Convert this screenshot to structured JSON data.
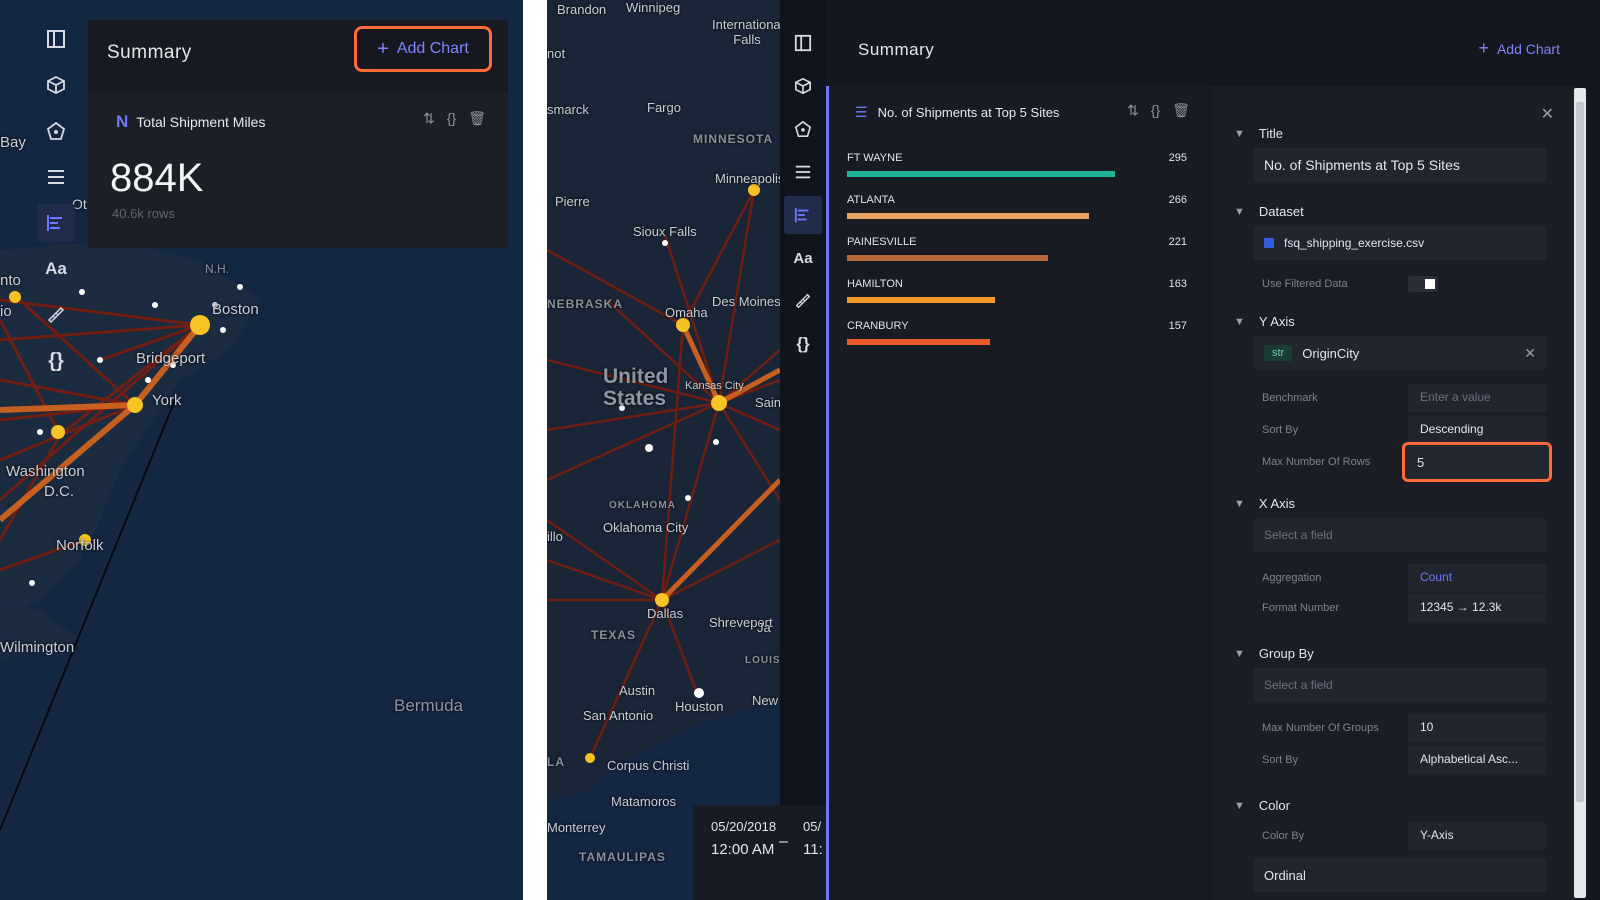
{
  "left": {
    "summary_title": "Summary",
    "add_chart_label": "Add Chart",
    "card": {
      "title": "Total Shipment Miles",
      "value": "884K",
      "rows": "40.6k rows"
    },
    "map_labels": {
      "bay": "Bay",
      "ot": "Ot",
      "nh": "N.H.",
      "boston": "Boston",
      "bridgeport": "Bridgeport",
      "york": "York",
      "washington": "Washington",
      "dc": "D.C.",
      "norfolk": "Norfolk",
      "wilmington": "Wilmington",
      "bermuda": "Bermuda",
      "nto": "nto",
      "io": "io"
    },
    "rail_icon_text": "Aa"
  },
  "right": {
    "summary_title": "Summary",
    "add_chart_label": "Add Chart",
    "rail_icon_text": "Aa",
    "map_labels": {
      "brandon": "Brandon",
      "winnipeg": "Winnipeg",
      "intl_falls": "International Falls",
      "not": "not",
      "bismarck": "smarck",
      "fargo": "Fargo",
      "minnesota": "MINNESOTA",
      "minneapolis": "Minneapolis",
      "pierre": "Pierre",
      "sioux_falls": "Sioux Falls",
      "nebraska": "NEBRASKA",
      "des_moines": "Des Moines",
      "omaha": "Omaha",
      "united_states": "United States",
      "kansas_city": "Kansas City",
      "saint": "Sain",
      "oklahoma": "OKLAHOMA",
      "oklahoma_city": "Oklahoma City",
      "illo": "illo",
      "texas": "TEXAS",
      "dallas": "Dallas",
      "shreveport": "Shreveport",
      "louisiana": "LOUISIANA",
      "austin": "Austin",
      "san_antonio": "San Antonio",
      "houston": "Houston",
      "new": "New",
      "corpus_christi": "Corpus Christi",
      "matamoros": "Matamoros",
      "monterrey": "Monterrey",
      "tamaulipas": "TAMAULIPAS",
      "la": "LA",
      "ja": "Ja"
    },
    "chart_card": {
      "title": "No. of Shipments at Top 5 Sites"
    },
    "time": {
      "start_date": "05/20/2018",
      "start_time": "12:00 AM",
      "end_date": "05/",
      "end_time": "11:"
    },
    "config": {
      "title_section": "Title",
      "title_value": "No. of Shipments at Top 5 Sites",
      "dataset_section": "Dataset",
      "dataset_value": "fsq_shipping_exercise.csv",
      "use_filtered_label": "Use Filtered Data",
      "yaxis_section": "Y Axis",
      "yaxis_type": "str",
      "yaxis_field": "OriginCity",
      "benchmark_label": "Benchmark",
      "benchmark_placeholder": "Enter a value",
      "sortby_label": "Sort By",
      "sortby_value": "Descending",
      "max_rows_label": "Max Number Of Rows",
      "max_rows_value": "5",
      "xaxis_section": "X Axis",
      "xaxis_placeholder": "Select a field",
      "aggregation_label": "Aggregation",
      "aggregation_value": "Count",
      "format_label": "Format Number",
      "format_value": "12345 → 12.3k",
      "groupby_section": "Group By",
      "groupby_placeholder": "Select a field",
      "max_groups_label": "Max Number Of Groups",
      "max_groups_value": "10",
      "group_sort_label": "Sort By",
      "group_sort_value": "Alphabetical Asc...",
      "color_section": "Color",
      "colorby_label": "Color By",
      "colorby_value": "Y-Axis",
      "color_type_value": "Ordinal"
    }
  },
  "chart_data": {
    "type": "bar",
    "orientation": "horizontal",
    "title": "No. of Shipments at Top 5 Sites",
    "categories": [
      "FT WAYNE",
      "ATLANTA",
      "PAINESVILLE",
      "HAMILTON",
      "CRANBURY"
    ],
    "values": [
      295,
      266,
      221,
      163,
      157
    ],
    "colors": [
      "#1fb39a",
      "#e6a15c",
      "#b5663a",
      "#f39a29",
      "#ec5a2a"
    ],
    "xlim": [
      0,
      330
    ]
  }
}
